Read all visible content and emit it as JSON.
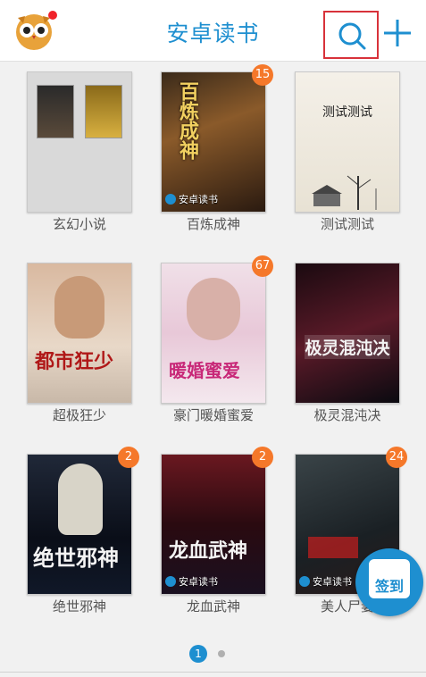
{
  "header": {
    "title": "安卓读书"
  },
  "brand_tag": "安卓读书",
  "books": [
    {
      "title": "玄幻小说",
      "badge": null
    },
    {
      "title": "百炼成神",
      "badge": "15",
      "cover_text": "百炼成神"
    },
    {
      "title": "测试测试",
      "badge": null,
      "cover_text": "测试测试"
    },
    {
      "title": "超极狂少",
      "badge": null,
      "cover_text": "都市狂少"
    },
    {
      "title": "豪门暖婚蜜爱",
      "badge": "67",
      "cover_text": "暖婚蜜爱"
    },
    {
      "title": "极灵混沌决",
      "badge": null,
      "cover_text": "极灵混沌决"
    },
    {
      "title": "绝世邪神",
      "badge": "2",
      "cover_text": "绝世邪神"
    },
    {
      "title": "龙血武神",
      "badge": "2",
      "cover_text": "龙血武神"
    },
    {
      "title": "美人尸妻",
      "badge": "24"
    }
  ],
  "checkin": {
    "label": "签到"
  },
  "pager": {
    "current": "1"
  },
  "colors": {
    "accent": "#1e8fd0",
    "badge": "#f5782a",
    "highlight": "#d8323a"
  }
}
